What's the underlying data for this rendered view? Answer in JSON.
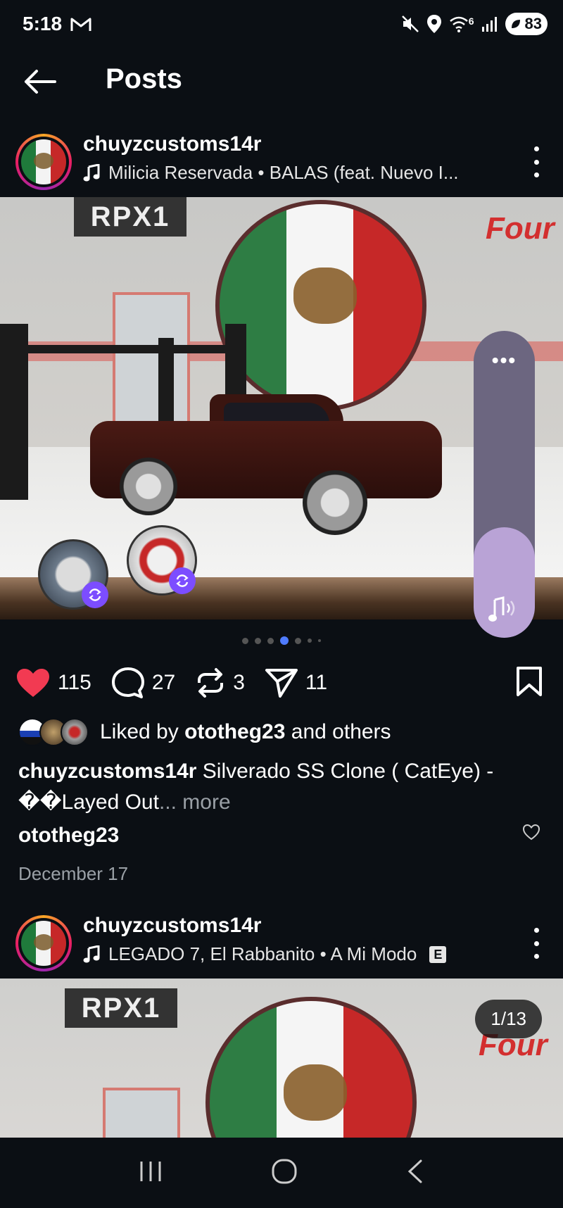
{
  "status_bar": {
    "time": "5:18",
    "network": "6",
    "battery": "83"
  },
  "header": {
    "title": "Posts"
  },
  "post1": {
    "username": "chuyzcustoms14r",
    "music": "Milicia Reservada • BALAS (feat. Nuevo I...",
    "image_signs": {
      "rpx": "RPX1",
      "four": "Four"
    },
    "counts": {
      "likes": "115",
      "comments": "27",
      "reposts": "3",
      "shares": "11"
    },
    "liked_by_prefix": "Liked by",
    "liked_by_user": "ototheg23",
    "liked_by_suffix": "and others",
    "caption_user": "chuyzcustoms14r",
    "caption_text": "Silverado SS Clone ( CatEye) - ��Layed Out",
    "caption_more": "... more",
    "comment_user": "ototheg23",
    "date": "December 17",
    "carousel_dots": 7,
    "carousel_active": 3
  },
  "volume": {
    "menu": "•••",
    "level": 0.36
  },
  "post2": {
    "username": "chuyzcustoms14r",
    "music": "LEGADO 7, El Rabbanito • A Mi Modo",
    "explicit": "E",
    "counter": "1/13"
  },
  "colors": {
    "background": "#0b0f14",
    "like_red": "#f23a52",
    "accent_blue": "#4f7cff",
    "tag_purple": "#7c4dff"
  }
}
